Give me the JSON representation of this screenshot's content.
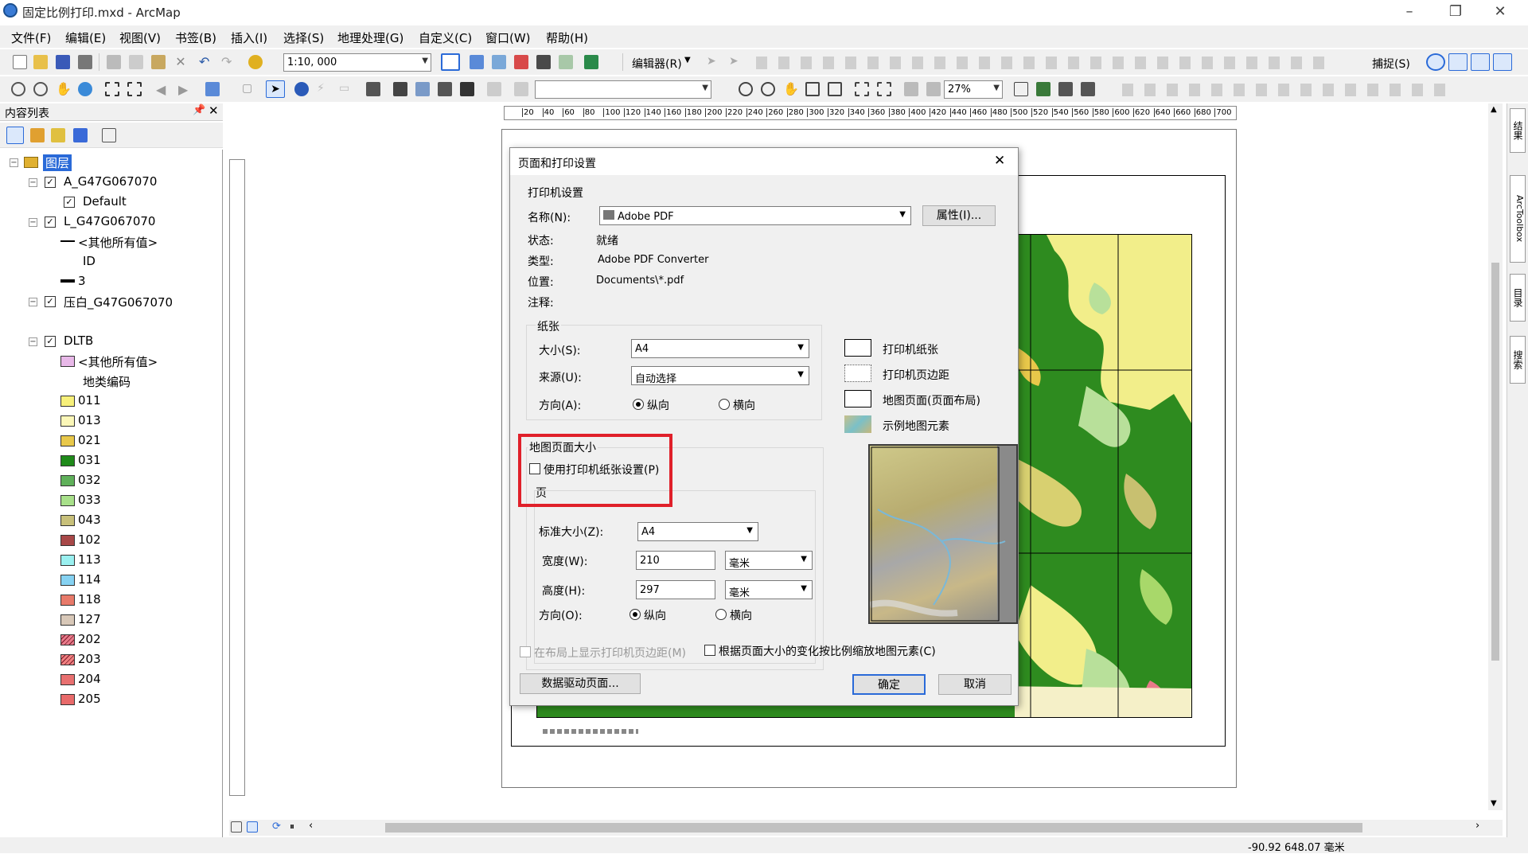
{
  "window": {
    "title": "固定比例打印.mxd - ArcMap"
  },
  "menu": [
    "文件(F)",
    "编辑(E)",
    "视图(V)",
    "书签(B)",
    "插入(I)",
    "选择(S)",
    "地理处理(G)",
    "自定义(C)",
    "窗口(W)",
    "帮助(H)"
  ],
  "toolbar": {
    "scale": "1:10, 000",
    "editor": "编辑器(R)",
    "snap": "捕捉(S)",
    "zoom": "27%"
  },
  "toc": {
    "title": "内容列表",
    "layers_root": "图层",
    "items": [
      {
        "label": "A_G47G067070"
      },
      {
        "label": "Default"
      },
      {
        "label": "L_G47G067070"
      },
      {
        "label": "<其他所有值>"
      },
      {
        "label": "ID"
      },
      {
        "label": "3"
      },
      {
        "label": "压白_G47G067070"
      },
      {
        "label": "DLTB"
      },
      {
        "label": "<其他所有值>"
      },
      {
        "label": "地类编码"
      }
    ],
    "codes": [
      {
        "code": "011",
        "color": "#f7f07a"
      },
      {
        "code": "013",
        "color": "#fbf7b8"
      },
      {
        "code": "021",
        "color": "#e8c84a"
      },
      {
        "code": "031",
        "color": "#1f8a1a"
      },
      {
        "code": "032",
        "color": "#5fb05a"
      },
      {
        "code": "033",
        "color": "#a8e08a"
      },
      {
        "code": "043",
        "color": "#c8c07a"
      },
      {
        "code": "102",
        "color": "#a84848"
      },
      {
        "code": "113",
        "color": "#9af0f0"
      },
      {
        "code": "114",
        "color": "#86d2f2"
      },
      {
        "code": "118",
        "color": "#e87a6a"
      },
      {
        "code": "127",
        "color": "#d8c8b8"
      },
      {
        "code": "202",
        "color": "#e87a8a"
      },
      {
        "code": "203",
        "color": "#f08080"
      },
      {
        "code": "204",
        "color": "#e87070"
      },
      {
        "code": "205",
        "color": "#e86a6a"
      }
    ]
  },
  "ruler": [
    "20",
    "40",
    "60",
    "80",
    "100",
    "120",
    "140",
    "160",
    "180",
    "200",
    "220",
    "240",
    "260",
    "280",
    "300",
    "320",
    "340",
    "360",
    "380",
    "400",
    "420",
    "440",
    "460",
    "480",
    "500",
    "520",
    "540",
    "560",
    "580",
    "600",
    "620",
    "640",
    "660",
    "680",
    "700"
  ],
  "dialog": {
    "title": "页面和打印设置",
    "printer_group": "打印机设置",
    "name_label": "名称(N):",
    "name_value": "Adobe PDF",
    "properties_button": "属性(I)...",
    "status_label": "状态:",
    "status_value": "就绪",
    "type_label": "类型:",
    "type_value": "Adobe PDF Converter",
    "location_label": "位置:",
    "location_value": "Documents\\*.pdf",
    "comment_label": "注释:",
    "paper_group": "纸张",
    "size_label": "大小(S):",
    "size_value": "A4",
    "source_label": "来源(U):",
    "source_value": "自动选择",
    "orient_label": "方向(A):",
    "portrait": "纵向",
    "landscape": "横向",
    "legend": [
      "打印机纸张",
      "打印机页边距",
      "地图页面(页面布局)",
      "示例地图元素"
    ],
    "map_page_group": "地图页面大小",
    "use_printer_paper": "使用打印机纸张设置(P)",
    "page_group": "页",
    "std_size_label": "标准大小(Z):",
    "std_size_value": "A4",
    "width_label": "宽度(W):",
    "width_value": "210",
    "width_unit": "毫米",
    "height_label": "高度(H):",
    "height_value": "297",
    "height_unit": "毫米",
    "page_orient_label": "方向(O):",
    "show_margins": "在布局上显示打印机页边距(M)",
    "scale_elements": "根据页面大小的变化按比例缩放地图元素(C)",
    "data_driven_button": "数据驱动页面...",
    "ok_button": "确定",
    "cancel_button": "取消"
  },
  "status": {
    "coords": "-90.92  648.07 毫米"
  },
  "rightbar": [
    "结果",
    "ArcToolbox",
    "目录",
    "搜索"
  ],
  "highlight_color": "#e0202a"
}
